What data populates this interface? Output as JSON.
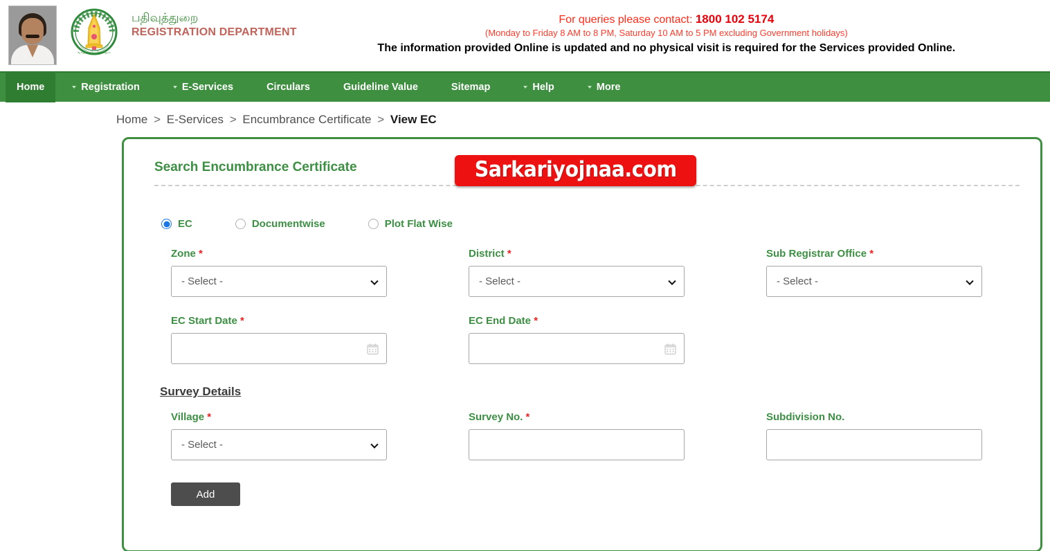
{
  "header": {
    "photo_alt": "chief-minister-photo",
    "emblem_alt": "tamil-nadu-state-emblem",
    "dept_tamil": "பதிவுத்துறை",
    "dept_english": "REGISTRATION DEPARTMENT",
    "contact_prefix": "For queries please contact: ",
    "contact_number": "1800 102 5174",
    "contact_hours": "(Monday to Friday 8 AM to 8 PM, Saturday 10 AM to 5 PM excluding Government holidays)",
    "notice": "The information provided Online is updated and no physical visit is required for the Services provided Online."
  },
  "nav": {
    "items": [
      {
        "label": "Home",
        "has_dropdown": false,
        "active": true
      },
      {
        "label": "Registration",
        "has_dropdown": true,
        "active": false
      },
      {
        "label": "E-Services",
        "has_dropdown": true,
        "active": false
      },
      {
        "label": "Circulars",
        "has_dropdown": false,
        "active": false
      },
      {
        "label": "Guideline Value",
        "has_dropdown": false,
        "active": false
      },
      {
        "label": "Sitemap",
        "has_dropdown": false,
        "active": false
      },
      {
        "label": "Help",
        "has_dropdown": true,
        "active": false
      },
      {
        "label": "More",
        "has_dropdown": true,
        "active": false
      }
    ]
  },
  "breadcrumb": {
    "items": [
      "Home",
      "E-Services",
      "Encumbrance Certificate"
    ],
    "separator": ">",
    "current": "View EC"
  },
  "card": {
    "title": "Search Encumbrance Certificate"
  },
  "watermark": {
    "text": "Sarkariyojnaa.com",
    "color": "#ee1111"
  },
  "search_mode": {
    "options": [
      {
        "label": "EC",
        "selected": true
      },
      {
        "label": "Documentwise",
        "selected": false
      },
      {
        "label": "Plot Flat Wise",
        "selected": false
      }
    ]
  },
  "form": {
    "zone": {
      "label": "Zone",
      "required": true,
      "value": "- Select -",
      "options": [
        "- Select -"
      ]
    },
    "district": {
      "label": "District",
      "required": true,
      "value": "- Select -",
      "options": [
        "- Select -"
      ]
    },
    "sub_registrar_office": {
      "label": "Sub Registrar Office",
      "required": true,
      "value": "- Select -",
      "options": [
        "- Select -"
      ]
    },
    "ec_start_date": {
      "label": "EC Start Date",
      "required": true,
      "value": "",
      "placeholder": ""
    },
    "ec_end_date": {
      "label": "EC End Date",
      "required": true,
      "value": "",
      "placeholder": ""
    }
  },
  "survey": {
    "section_title": "Survey Details",
    "village": {
      "label": "Village",
      "required": true,
      "value": "- Select -",
      "options": [
        "- Select -"
      ]
    },
    "survey_no": {
      "label": "Survey No.",
      "required": true,
      "value": "",
      "placeholder": ""
    },
    "subdivision_no": {
      "label": "Subdivision No.",
      "required": false,
      "value": "",
      "placeholder": ""
    },
    "add_button": "Add"
  },
  "colors": {
    "brand_green": "#3e8f3f",
    "label_green": "#3c8f43",
    "required_red": "#ee2222",
    "alert_red": "#ff2a17",
    "accent_blue": "#1877e8"
  }
}
